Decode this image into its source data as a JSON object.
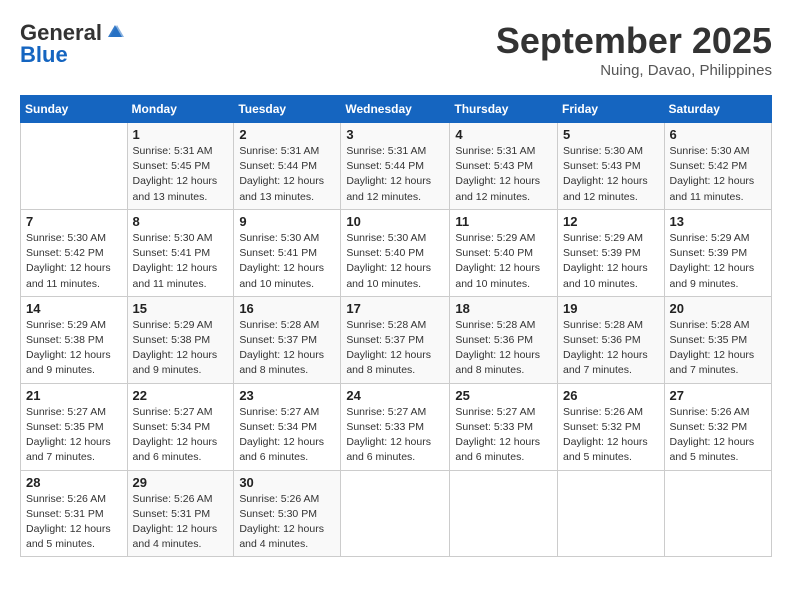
{
  "logo": {
    "general": "General",
    "blue": "Blue"
  },
  "header": {
    "title": "September 2025",
    "location": "Nuing, Davao, Philippines"
  },
  "days_of_week": [
    "Sunday",
    "Monday",
    "Tuesday",
    "Wednesday",
    "Thursday",
    "Friday",
    "Saturday"
  ],
  "weeks": [
    [
      {
        "day": "",
        "info": ""
      },
      {
        "day": "1",
        "info": "Sunrise: 5:31 AM\nSunset: 5:45 PM\nDaylight: 12 hours\nand 13 minutes."
      },
      {
        "day": "2",
        "info": "Sunrise: 5:31 AM\nSunset: 5:44 PM\nDaylight: 12 hours\nand 13 minutes."
      },
      {
        "day": "3",
        "info": "Sunrise: 5:31 AM\nSunset: 5:44 PM\nDaylight: 12 hours\nand 12 minutes."
      },
      {
        "day": "4",
        "info": "Sunrise: 5:31 AM\nSunset: 5:43 PM\nDaylight: 12 hours\nand 12 minutes."
      },
      {
        "day": "5",
        "info": "Sunrise: 5:30 AM\nSunset: 5:43 PM\nDaylight: 12 hours\nand 12 minutes."
      },
      {
        "day": "6",
        "info": "Sunrise: 5:30 AM\nSunset: 5:42 PM\nDaylight: 12 hours\nand 11 minutes."
      }
    ],
    [
      {
        "day": "7",
        "info": "Sunrise: 5:30 AM\nSunset: 5:42 PM\nDaylight: 12 hours\nand 11 minutes."
      },
      {
        "day": "8",
        "info": "Sunrise: 5:30 AM\nSunset: 5:41 PM\nDaylight: 12 hours\nand 11 minutes."
      },
      {
        "day": "9",
        "info": "Sunrise: 5:30 AM\nSunset: 5:41 PM\nDaylight: 12 hours\nand 10 minutes."
      },
      {
        "day": "10",
        "info": "Sunrise: 5:30 AM\nSunset: 5:40 PM\nDaylight: 12 hours\nand 10 minutes."
      },
      {
        "day": "11",
        "info": "Sunrise: 5:29 AM\nSunset: 5:40 PM\nDaylight: 12 hours\nand 10 minutes."
      },
      {
        "day": "12",
        "info": "Sunrise: 5:29 AM\nSunset: 5:39 PM\nDaylight: 12 hours\nand 10 minutes."
      },
      {
        "day": "13",
        "info": "Sunrise: 5:29 AM\nSunset: 5:39 PM\nDaylight: 12 hours\nand 9 minutes."
      }
    ],
    [
      {
        "day": "14",
        "info": "Sunrise: 5:29 AM\nSunset: 5:38 PM\nDaylight: 12 hours\nand 9 minutes."
      },
      {
        "day": "15",
        "info": "Sunrise: 5:29 AM\nSunset: 5:38 PM\nDaylight: 12 hours\nand 9 minutes."
      },
      {
        "day": "16",
        "info": "Sunrise: 5:28 AM\nSunset: 5:37 PM\nDaylight: 12 hours\nand 8 minutes."
      },
      {
        "day": "17",
        "info": "Sunrise: 5:28 AM\nSunset: 5:37 PM\nDaylight: 12 hours\nand 8 minutes."
      },
      {
        "day": "18",
        "info": "Sunrise: 5:28 AM\nSunset: 5:36 PM\nDaylight: 12 hours\nand 8 minutes."
      },
      {
        "day": "19",
        "info": "Sunrise: 5:28 AM\nSunset: 5:36 PM\nDaylight: 12 hours\nand 7 minutes."
      },
      {
        "day": "20",
        "info": "Sunrise: 5:28 AM\nSunset: 5:35 PM\nDaylight: 12 hours\nand 7 minutes."
      }
    ],
    [
      {
        "day": "21",
        "info": "Sunrise: 5:27 AM\nSunset: 5:35 PM\nDaylight: 12 hours\nand 7 minutes."
      },
      {
        "day": "22",
        "info": "Sunrise: 5:27 AM\nSunset: 5:34 PM\nDaylight: 12 hours\nand 6 minutes."
      },
      {
        "day": "23",
        "info": "Sunrise: 5:27 AM\nSunset: 5:34 PM\nDaylight: 12 hours\nand 6 minutes."
      },
      {
        "day": "24",
        "info": "Sunrise: 5:27 AM\nSunset: 5:33 PM\nDaylight: 12 hours\nand 6 minutes."
      },
      {
        "day": "25",
        "info": "Sunrise: 5:27 AM\nSunset: 5:33 PM\nDaylight: 12 hours\nand 6 minutes."
      },
      {
        "day": "26",
        "info": "Sunrise: 5:26 AM\nSunset: 5:32 PM\nDaylight: 12 hours\nand 5 minutes."
      },
      {
        "day": "27",
        "info": "Sunrise: 5:26 AM\nSunset: 5:32 PM\nDaylight: 12 hours\nand 5 minutes."
      }
    ],
    [
      {
        "day": "28",
        "info": "Sunrise: 5:26 AM\nSunset: 5:31 PM\nDaylight: 12 hours\nand 5 minutes."
      },
      {
        "day": "29",
        "info": "Sunrise: 5:26 AM\nSunset: 5:31 PM\nDaylight: 12 hours\nand 4 minutes."
      },
      {
        "day": "30",
        "info": "Sunrise: 5:26 AM\nSunset: 5:30 PM\nDaylight: 12 hours\nand 4 minutes."
      },
      {
        "day": "",
        "info": ""
      },
      {
        "day": "",
        "info": ""
      },
      {
        "day": "",
        "info": ""
      },
      {
        "day": "",
        "info": ""
      }
    ]
  ]
}
